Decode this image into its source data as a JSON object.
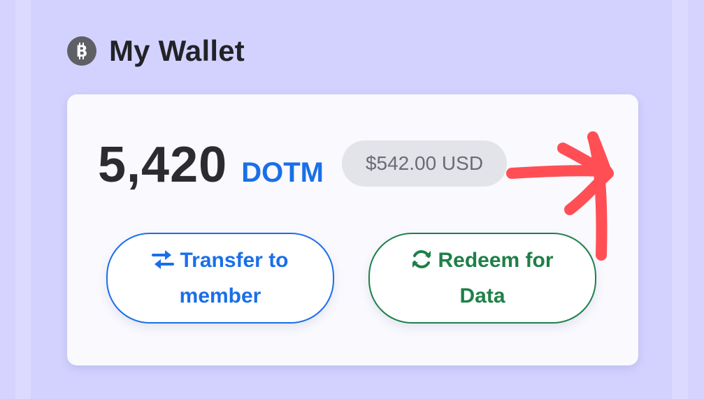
{
  "header": {
    "title": "My Wallet",
    "icon": "bitcoin-icon"
  },
  "wallet": {
    "balance": "5,420",
    "unit": "DOTM",
    "usd_value": "$542.00 USD"
  },
  "actions": {
    "transfer": {
      "line1": "Transfer to",
      "line2": "member",
      "icon": "swap-arrows-icon"
    },
    "redeem": {
      "line1": "Redeem for",
      "line2": "Data",
      "icon": "refresh-icon"
    }
  },
  "annotation": {
    "icon": "hand-drawn-arrow",
    "color": "#ff4f55"
  },
  "colors": {
    "background": "#d3d2ff",
    "card": "#f9f9fe",
    "accent_blue": "#1a6fe8",
    "accent_green": "#1e8048",
    "text_dark": "#2b2b30"
  }
}
